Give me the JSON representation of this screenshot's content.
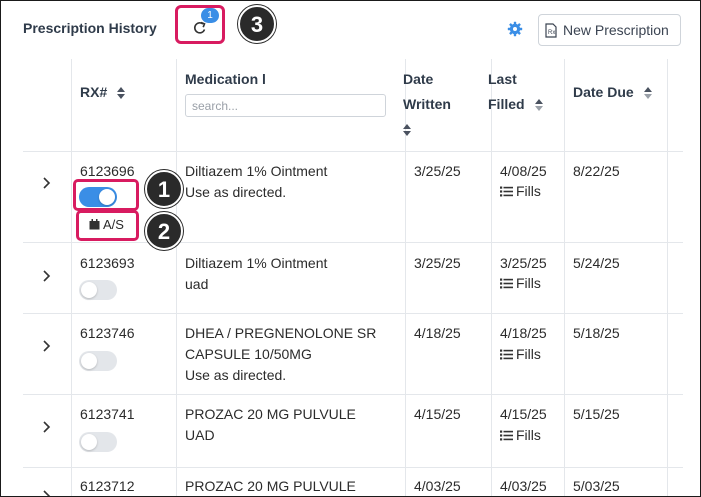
{
  "header": {
    "title": "Prescription History",
    "refresh_badge": "1",
    "new_button": "New Prescription"
  },
  "callouts": [
    "1",
    "2",
    "3"
  ],
  "columns": {
    "rx": "RX#",
    "medication": "Medication l",
    "date_written_1": "Date",
    "date_written_2": "Written",
    "last_filled_1": "Last",
    "last_filled_2": "Filled",
    "date_due": "Date Due"
  },
  "search": {
    "placeholder": "search..."
  },
  "fills_label": "Fills",
  "as_label": "A/S",
  "rows": [
    {
      "rx": "6123696",
      "med1": "Diltiazem 1% Ointment",
      "med2": "Use as directed.",
      "med3": "",
      "written": "3/25/25",
      "filled": "4/08/25",
      "due": "8/22/25",
      "toggle_on": true
    },
    {
      "rx": "6123693",
      "med1": "Diltiazem 1% Ointment",
      "med2": "uad",
      "med3": "",
      "written": "3/25/25",
      "filled": "3/25/25",
      "due": "5/24/25",
      "toggle_on": false
    },
    {
      "rx": "6123746",
      "med1": "DHEA / PREGNENOLONE SR",
      "med2": "CAPSULE 10/50MG",
      "med3": "Use as directed.",
      "written": "4/18/25",
      "filled": "4/18/25",
      "due": "5/18/25",
      "toggle_on": false
    },
    {
      "rx": "6123741",
      "med1": "PROZAC 20 MG PULVULE",
      "med2": "UAD",
      "med3": "",
      "written": "4/15/25",
      "filled": "4/15/25",
      "due": "5/15/25",
      "toggle_on": false
    },
    {
      "rx": "6123712",
      "med1": "PROZAC 20 MG PULVULE",
      "med2": "",
      "med3": "",
      "written": "4/03/25",
      "filled": "4/03/25",
      "due": "5/03/25",
      "toggle_on": false
    }
  ],
  "colors": {
    "accent": "#3a8ee6",
    "highlight": "#d81b60",
    "callout": "#2a2a2a"
  }
}
